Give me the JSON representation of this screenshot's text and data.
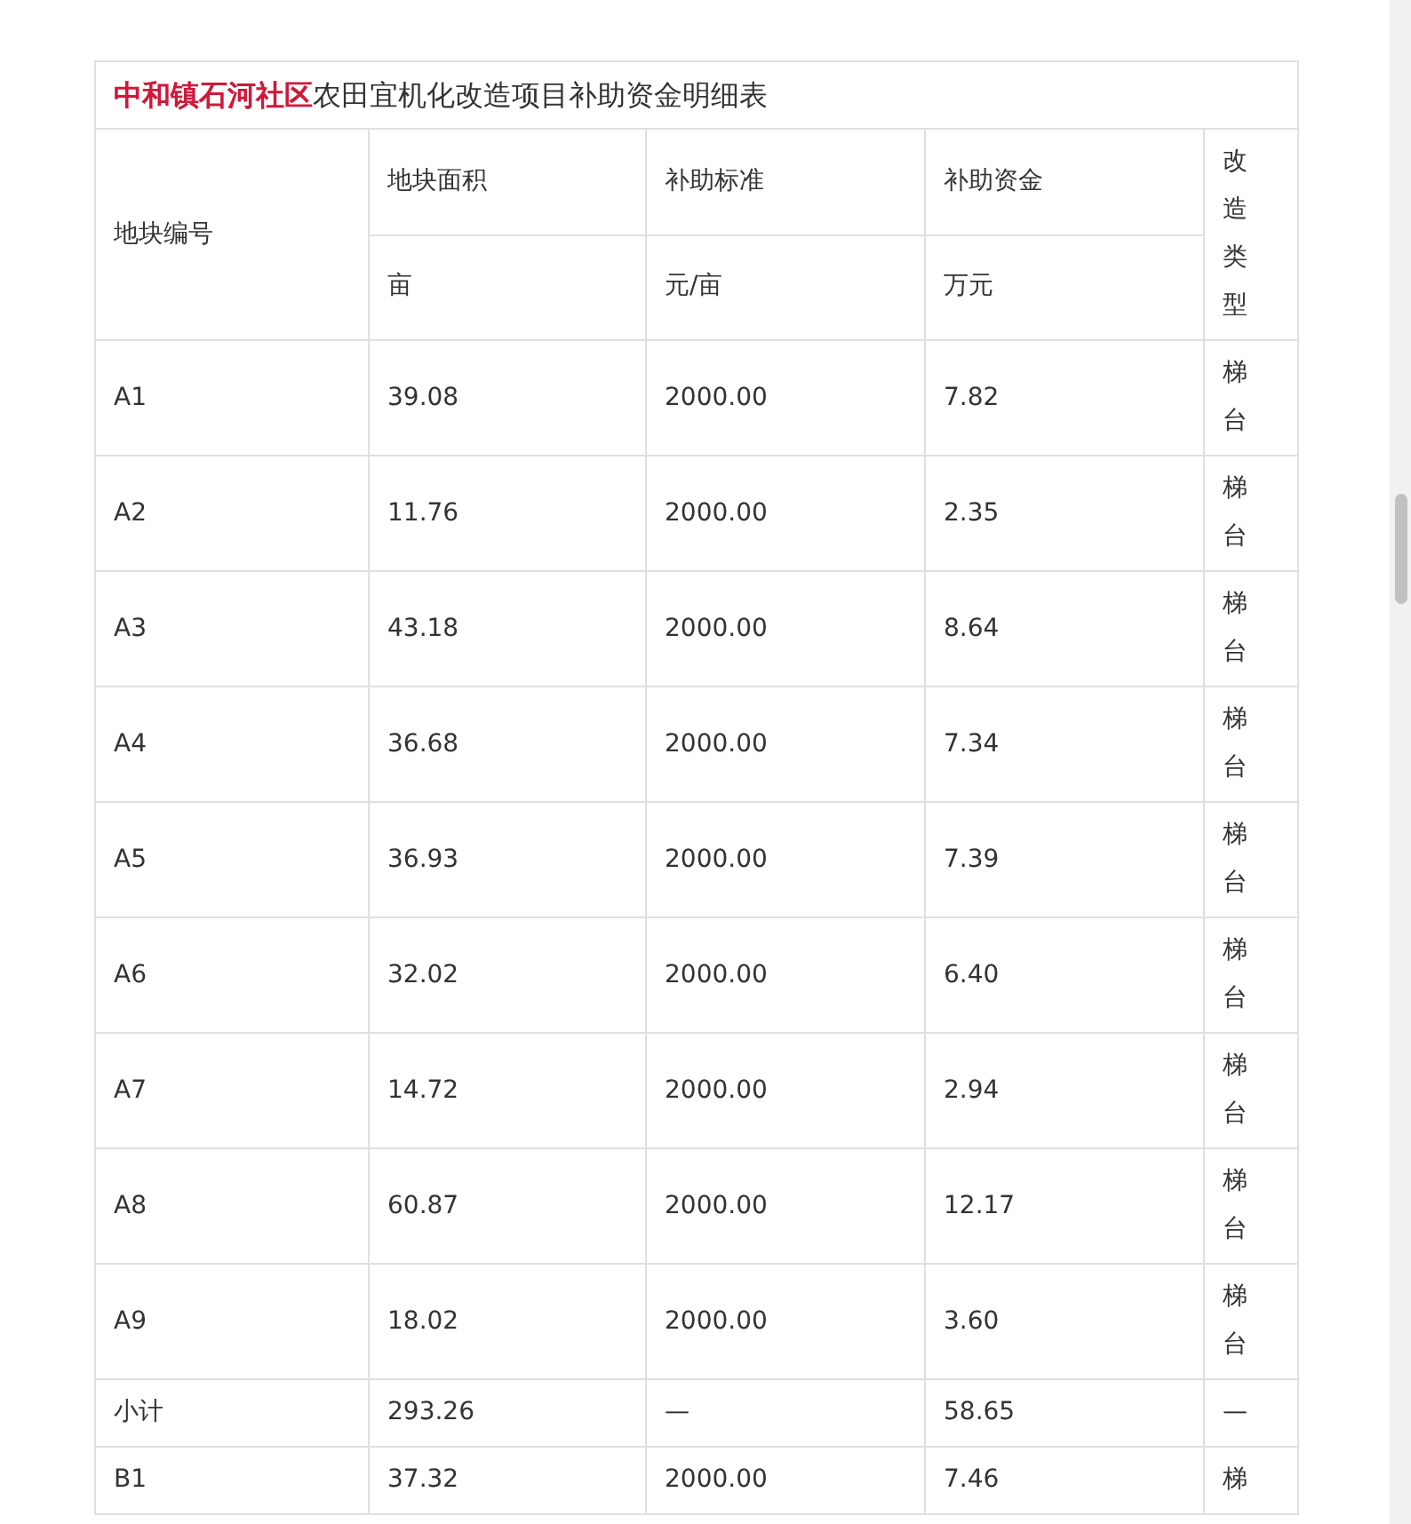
{
  "table": {
    "title": "**中和镇石河社区**农田宜机化改造项目补助资金明细表",
    "columns": [
      {
        "label": "地块编号"
      },
      {
        "label": "地块面积",
        "unit": "亩"
      },
      {
        "label": "补助标准",
        "unit": "元/亩"
      },
      {
        "label": "补助资金",
        "unit": "万元"
      },
      {
        "label": "改造类型"
      }
    ],
    "rows": [
      [
        "A1",
        "39.08",
        "2000.00",
        "7.82",
        "梯台"
      ],
      [
        "A2",
        "11.76",
        "2000.00",
        "2.35",
        "梯台"
      ],
      [
        "A3",
        "43.18",
        "2000.00",
        "8.64",
        "梯台"
      ],
      [
        "A4",
        "36.68",
        "2000.00",
        "7.34",
        "梯台"
      ],
      [
        "A5",
        "36.93",
        "2000.00",
        "7.39",
        "梯台"
      ],
      [
        "A6",
        "32.02",
        "2000.00",
        "6.40",
        "梯台"
      ],
      [
        "A7",
        "14.72",
        "2000.00",
        "2.94",
        "梯台"
      ],
      [
        "A8",
        "60.87",
        "2000.00",
        "12.17",
        "梯台"
      ],
      [
        "A9",
        "18.02",
        "2000.00",
        "3.60",
        "梯台"
      ],
      [
        "小计",
        "293.26",
        "—",
        "58.65",
        "—"
      ],
      [
        "B1",
        "37.32",
        "2000.00",
        "7.46",
        "梯"
      ]
    ]
  }
}
